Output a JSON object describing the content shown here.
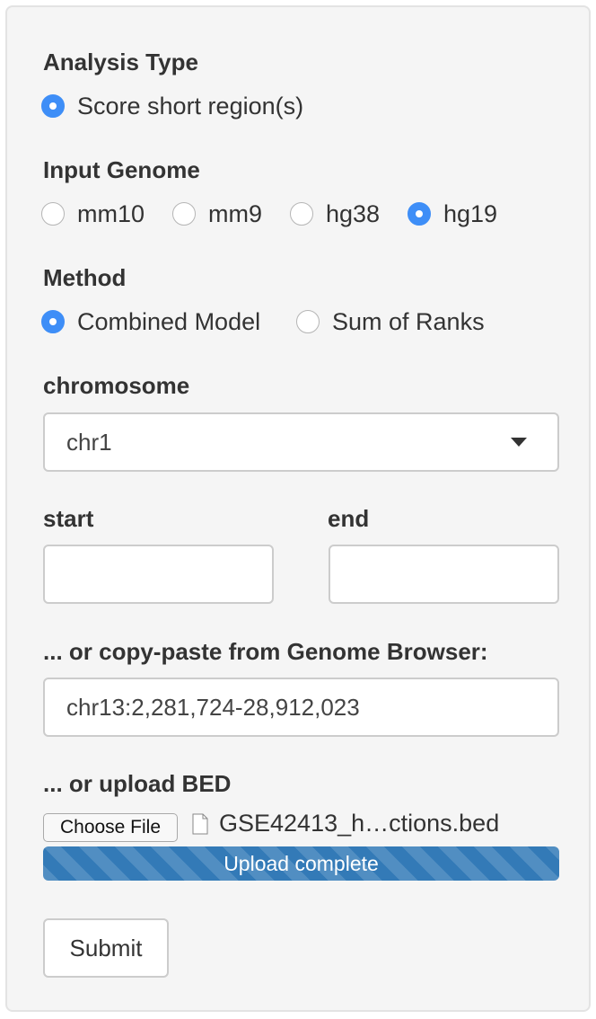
{
  "analysis_type": {
    "label": "Analysis Type",
    "options": [
      {
        "label": "Score short region(s)",
        "checked": true
      }
    ]
  },
  "input_genome": {
    "label": "Input Genome",
    "options": [
      {
        "label": "mm10",
        "checked": false
      },
      {
        "label": "mm9",
        "checked": false
      },
      {
        "label": "hg38",
        "checked": false
      },
      {
        "label": "hg19",
        "checked": true
      }
    ]
  },
  "method": {
    "label": "Method",
    "options": [
      {
        "label": "Combined Model",
        "checked": true
      },
      {
        "label": "Sum of Ranks",
        "checked": false
      }
    ]
  },
  "chromosome": {
    "label": "chromosome",
    "selected": "chr1"
  },
  "start": {
    "label": "start",
    "value": ""
  },
  "end": {
    "label": "end",
    "value": ""
  },
  "genome_browser": {
    "label": "... or copy-paste from Genome Browser:",
    "value": "chr13:2,281,724-28,912,023"
  },
  "upload": {
    "label": "... or upload BED",
    "button_label": "Choose File",
    "file_name": "GSE42413_h…ctions.bed",
    "progress_text": "Upload complete",
    "progress_fraction": 1.0
  },
  "submit_label": "Submit",
  "colors": {
    "accent": "#3e8ef7",
    "progress": "#337ab7",
    "panel_bg": "#f5f5f5"
  }
}
